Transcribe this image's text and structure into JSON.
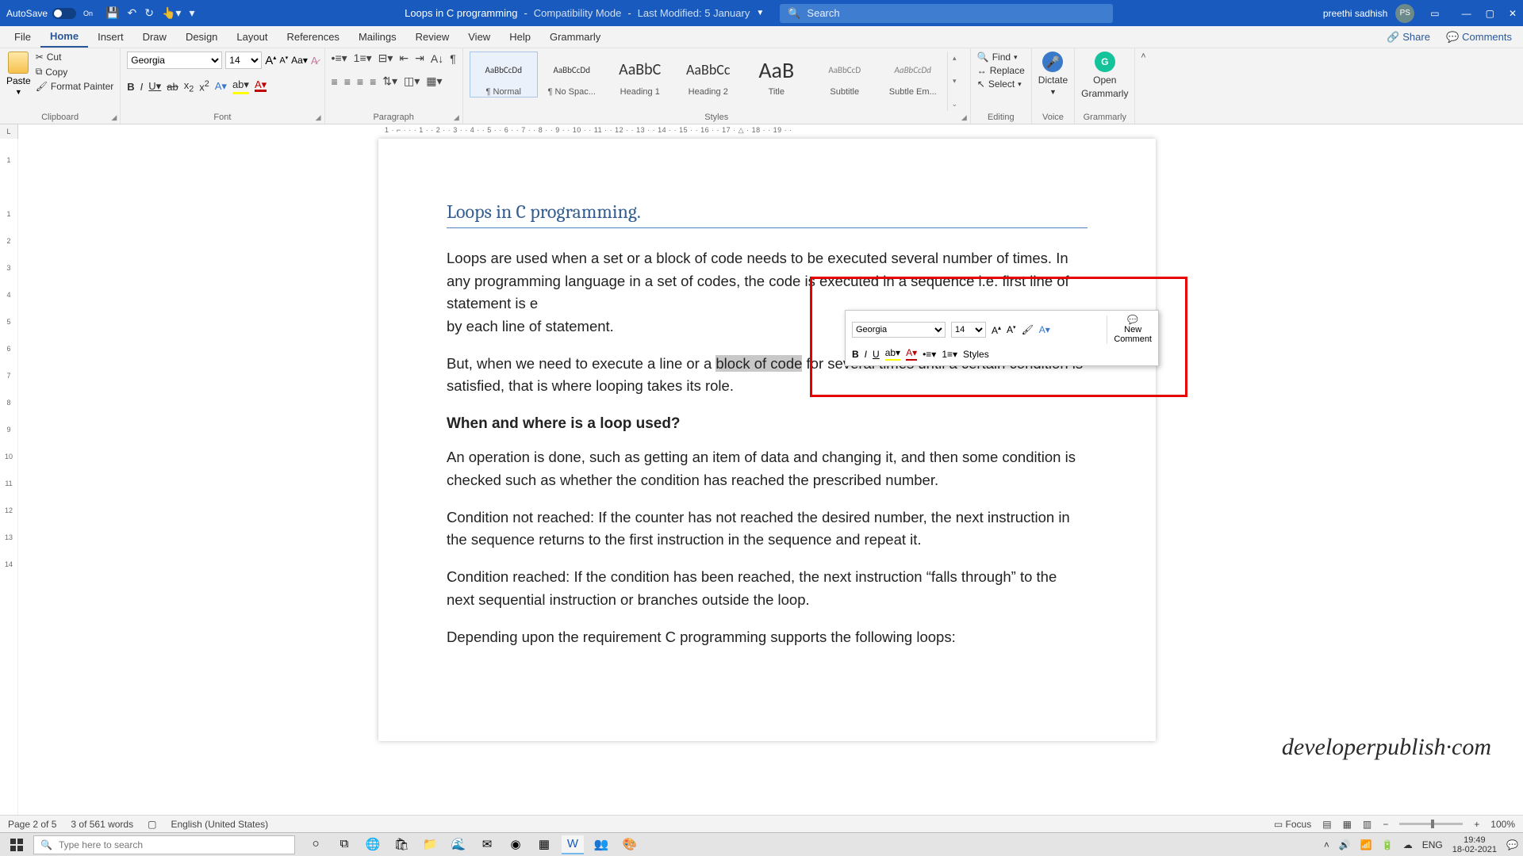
{
  "titlebar": {
    "autosave": "AutoSave",
    "autosave_state": "On",
    "doc_name": "Loops in C programming",
    "compat": "Compatibility Mode",
    "modified": "Last Modified: 5 January",
    "search_placeholder": "Search",
    "user": "preethi sadhish",
    "user_initials": "PS"
  },
  "ribbon_tabs": [
    "File",
    "Home",
    "Insert",
    "Draw",
    "Design",
    "Layout",
    "References",
    "Mailings",
    "Review",
    "View",
    "Help",
    "Grammarly"
  ],
  "ribbon_right": {
    "share": "Share",
    "comments": "Comments"
  },
  "clipboard": {
    "paste": "Paste",
    "cut": "Cut",
    "copy": "Copy",
    "format_painter": "Format Painter",
    "label": "Clipboard"
  },
  "font": {
    "name": "Georgia",
    "size": "14",
    "label": "Font"
  },
  "paragraph": {
    "label": "Paragraph"
  },
  "styles": {
    "label": "Styles",
    "items": [
      {
        "name": "¶ Normal",
        "preview": "AaBbCcDd",
        "cls": ""
      },
      {
        "name": "¶ No Spac...",
        "preview": "AaBbCcDd",
        "cls": ""
      },
      {
        "name": "Heading 1",
        "preview": "AaBbC",
        "cls": "aab-med"
      },
      {
        "name": "Heading 2",
        "preview": "AaBbCc",
        "cls": "aab-med2"
      },
      {
        "name": "Title",
        "preview": "AaB",
        "cls": "aab-big"
      },
      {
        "name": "Subtitle",
        "preview": "AaBbCcD",
        "cls": ""
      },
      {
        "name": "Subtle Em...",
        "preview": "AaBbCcDd",
        "cls": ""
      }
    ]
  },
  "editing": {
    "find": "Find",
    "replace": "Replace",
    "select": "Select",
    "label": "Editing"
  },
  "voice": {
    "dictate": "Dictate",
    "label": "Voice"
  },
  "grammarly": {
    "open": "Open",
    "name": "Grammarly",
    "label": "Grammarly"
  },
  "ruler_h": "1 · ⌐ ·   ·   · 1 ·   · 2 ·   · 3 ·   · 4 ·   · 5 ·   · 6 ·   · 7 ·   · 8 ·   · 9 ·   · 10 ·   · 11 ·   · 12 ·   · 13 ·   · 14 ·   · 15 ·   · 16 ·   · 17 · △ · 18 ·   · 19 ·   ·",
  "doc": {
    "title": "Loops in C programming.",
    "p1a": "Loops are used when a set or a block of code needs to be executed several number of times. In any programming language",
    "p1b": " in a set of codes, the code is executed in a sequence i.e. first line of statement is e",
    "p1c": "by each line of statement.",
    "p2a": "But, when we need to execute a line or a ",
    "p2_sel": "block of code",
    "p2b": " for several times until a certain condition is satisfied, that is where looping takes its role.",
    "q": "When and where is a loop used?",
    "p3": "An operation is done, such as getting an item of data and changing it, and then some condition is checked such as whether the condition has reached the prescribed number.",
    "p4": "Condition not reached: If the counter has not reached the desired number, the next instruction in the sequence returns to the first instruction in the sequence and repeat it.",
    "p5": "Condition reached: If the condition has been reached, the next instruction “falls through” to the next sequential instruction or branches outside the loop.",
    "p6": "Depending upon the requirement C programming supports the following loops:"
  },
  "mini": {
    "font": "Georgia",
    "size": "14",
    "styles": "Styles",
    "new": "New",
    "comment": "Comment"
  },
  "watermark": "developerpublish·com",
  "status": {
    "page": "Page 2 of 5",
    "words": "3 of 561 words",
    "lang": "English (United States)",
    "focus": "Focus",
    "zoom": "100%"
  },
  "taskbar": {
    "search": "Type here to search",
    "lang": "ENG",
    "time": "19:49",
    "date": "18-02-2021"
  }
}
